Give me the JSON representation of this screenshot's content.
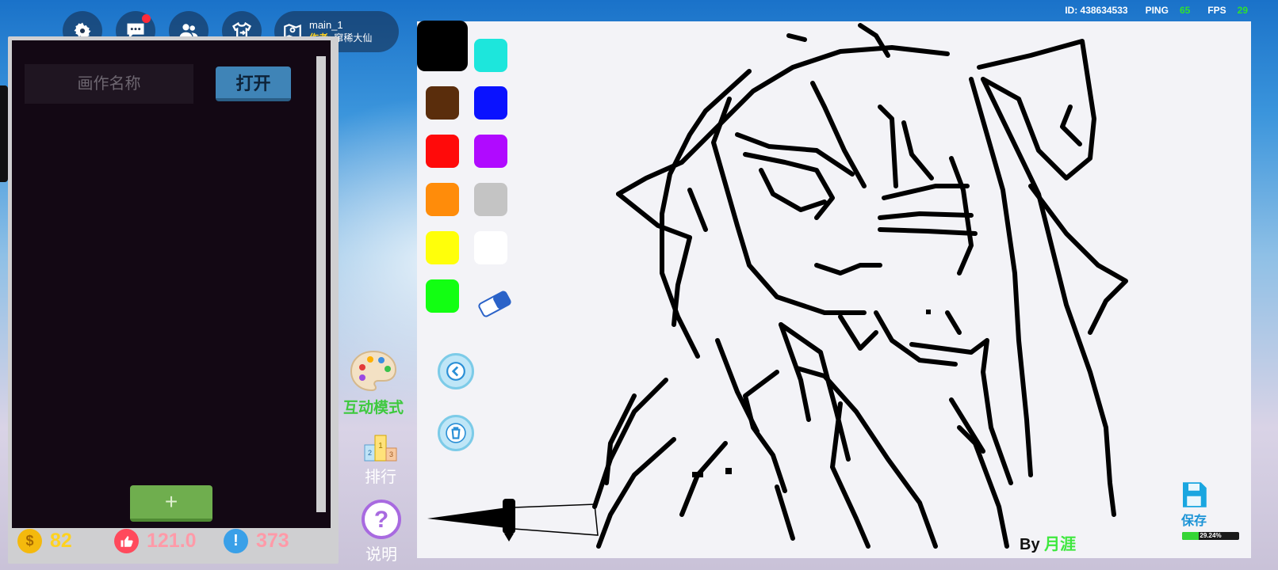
{
  "topbar": {
    "icons": [
      "gear-icon",
      "chat-icon",
      "friends-icon",
      "wardrobe-icon"
    ],
    "map": {
      "name": "main_1",
      "author_key": "作者:",
      "author": "窜稀大仙"
    },
    "stats": {
      "id_label": "ID: 438634533",
      "ping_label": "PING",
      "ping": "65",
      "fps_label": "FPS",
      "fps": "29"
    }
  },
  "left_panel": {
    "name_placeholder": "画作名称",
    "open_label": "打开",
    "add_label": "+"
  },
  "bottom_stats": {
    "coins": "82",
    "likes": "121.0",
    "alerts": "373"
  },
  "side_tools": {
    "interactive": "互动模式",
    "rank": "排行",
    "help": "说明"
  },
  "palette": {
    "colors": [
      "#000000",
      "#1de6dc",
      "#5a2d0c",
      "#0a12ff",
      "#ff0a0a",
      "#b00aff",
      "#ff8c0a",
      "#c4c4c4",
      "#ffff0a",
      "#ffffff",
      "#12ff12"
    ],
    "selected": "#000000",
    "tools": [
      "eraser-icon",
      "undo-icon",
      "trash-icon"
    ]
  },
  "canvas": {
    "by_label": "By",
    "artist": "月涯"
  },
  "save": {
    "label": "保存",
    "progress_text": "29.24%",
    "progress": 0.2924
  },
  "colors": {
    "accent_blue": "#1a93d6",
    "panel_bg": "#130814",
    "coin": "#ffd21f",
    "likes": "#ff5a6a",
    "alerts": "#ff9aa8"
  }
}
